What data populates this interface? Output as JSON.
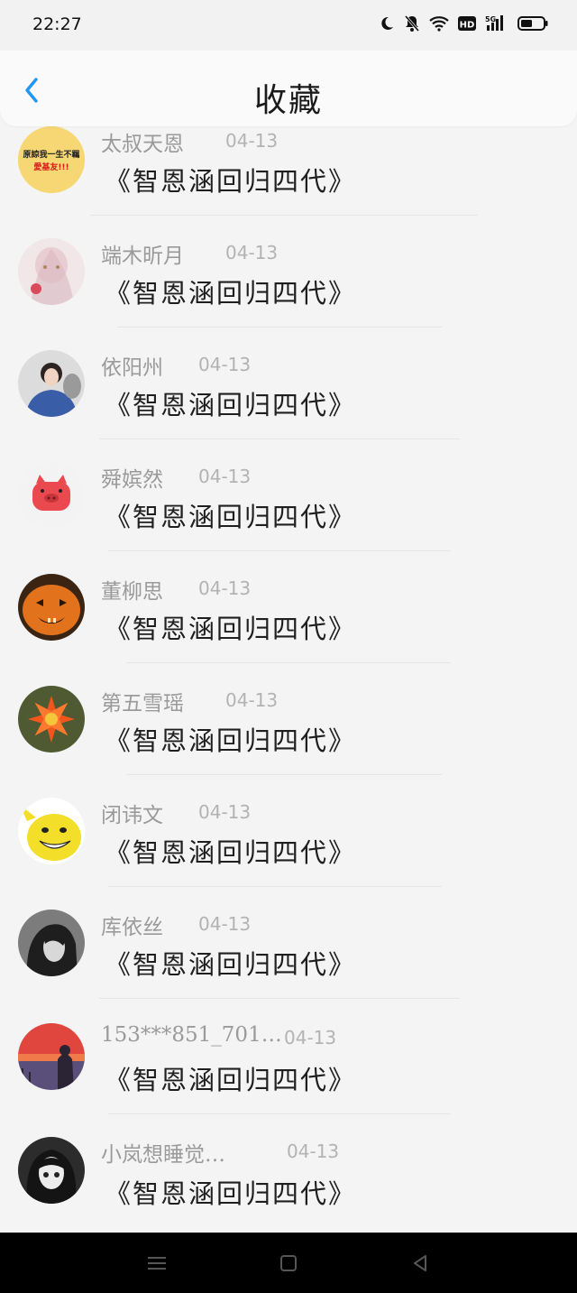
{
  "status_bar": {
    "time": "22:27",
    "icons": [
      "moon-icon",
      "bell-muted-icon",
      "wifi-icon",
      "hd-icon",
      "signal-5g-icon",
      "battery-icon"
    ]
  },
  "header": {
    "title": "收藏",
    "back_icon": "chevron-left-icon",
    "accent": "#2196f3"
  },
  "items": [
    {
      "name": "太叔天恩",
      "time": "04-13",
      "content": "《智恩涵回归四代》",
      "avatar": "text-badge-avatar",
      "avatar_text_1": "原諒我一生不羈",
      "avatar_text_2": "愛基友!!!"
    },
    {
      "name": "端木昕月",
      "time": "04-13",
      "content": "《智恩涵回归四代》",
      "avatar": "anime-girl-avatar"
    },
    {
      "name": "依阳州",
      "time": "04-13",
      "content": "《智恩涵回归四代》",
      "avatar": "girl-photo-avatar"
    },
    {
      "name": "舜嫔然",
      "time": "04-13",
      "content": "《智恩涵回归四代》",
      "avatar": "pig-avatar"
    },
    {
      "name": "董柳思",
      "time": "04-13",
      "content": "《智恩涵回归四代》",
      "avatar": "pumpkin-avatar"
    },
    {
      "name": "第五雪瑶",
      "time": "04-13",
      "content": "《智恩涵回归四代》",
      "avatar": "flower-avatar"
    },
    {
      "name": "闭讳文",
      "time": "04-13",
      "content": "《智恩涵回归四代》",
      "avatar": "pikachu-avatar"
    },
    {
      "name": "库依丝",
      "time": "04-13",
      "content": "《智恩涵回归四代》",
      "avatar": "bw-girl-avatar"
    },
    {
      "name": "153***851_701…",
      "time": "04-13",
      "content": "《智恩涵回归四代》",
      "avatar": "sunset-avatar"
    },
    {
      "name": "小岚想睡觉…",
      "time": "04-13",
      "content": "《智恩涵回归四代》",
      "avatar": "anime-dark-avatar"
    }
  ],
  "nav_bar": {
    "buttons": [
      "menu-icon",
      "home-square-icon",
      "back-triangle-icon"
    ]
  }
}
